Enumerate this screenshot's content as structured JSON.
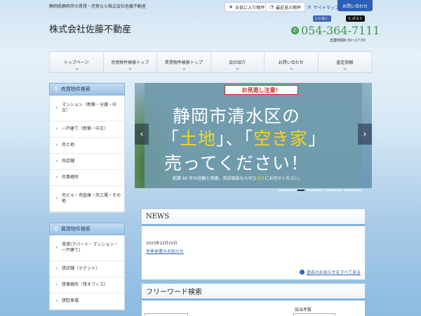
{
  "header": {
    "tagline": "静岡県静岡市の賃貸・売買なら株式会社佐藤不動産",
    "brand": "株式会社佐藤不動産",
    "phone": "054-364-7111",
    "hours": "営業時間8:30～17:30",
    "util": {
      "favorites": "お気に入り物件",
      "recent": "最近見た物件",
      "sitemap": "サイトマップ",
      "contact": "お問い合わせ"
    },
    "sns": {
      "facebook": "いいね！",
      "x": "ポスト"
    }
  },
  "nav": [
    {
      "label": "トップページ"
    },
    {
      "label": "売買物件検索トップ"
    },
    {
      "label": "賃貸物件検索トップ"
    },
    {
      "label": "会社紹介"
    },
    {
      "label": "お問い合わせ"
    },
    {
      "label": "査定依頼"
    }
  ],
  "sidebar": {
    "sale_title": "売買物件検索",
    "sale_items": [
      {
        "label": "マンション（新築・分譲・中古）"
      },
      {
        "label": "一戸建て（新築・中古）"
      },
      {
        "label": "売土地"
      },
      {
        "label": "売店舗"
      },
      {
        "label": "売事務所"
      },
      {
        "label": "売ビル・売倉庫・売工場・その他"
      }
    ],
    "rent_title": "賃貸物件検索",
    "rent_items": [
      {
        "label": "賃貸(アパート・マンション・一戸建て)"
      },
      {
        "label": "貸店舗（テナント）"
      },
      {
        "label": "貸事務所（貸オフィス）"
      },
      {
        "label": "貸駐車場"
      }
    ]
  },
  "banner": {
    "tag": "お見逃し注意！",
    "line1": "静岡市清水区の",
    "line2_q1": "「",
    "line2_a": "土地",
    "line2_q2": "」、「",
    "line2_b": "空き家",
    "line2_q3": "」",
    "line3": "売ってください！",
    "sub_a": "創業 60 年の信頼と実績。売却相談ならぜひ",
    "sub_b": "当社",
    "sub_c": "にお任せください。"
  },
  "news": {
    "title": "NEWS",
    "date": "2023年12月20日",
    "item": "冬季休業のお知らせ",
    "more": "過去のお知らせをすべて見る"
  },
  "free_search": {
    "title": "フリーワード検索",
    "count_label": "該当件数"
  },
  "icons": {
    "fav": "star-icon",
    "recent": "clock-icon",
    "sitemap": "sitemap-icon",
    "phone": "phone-icon",
    "search": "magnifier-icon"
  }
}
